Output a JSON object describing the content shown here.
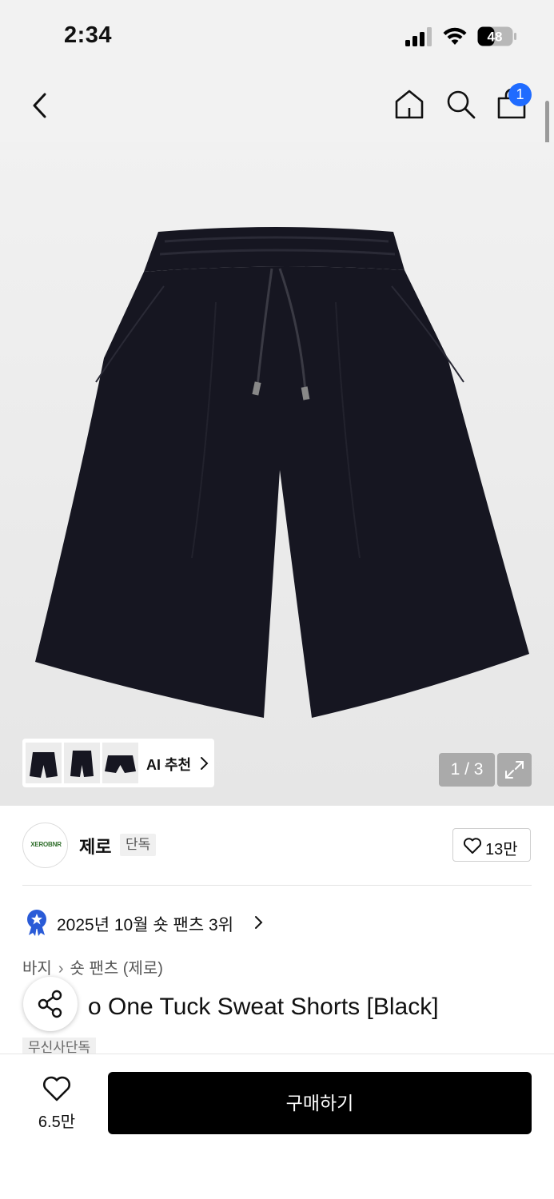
{
  "status_bar": {
    "time": "2:34",
    "battery": "48"
  },
  "nav": {
    "cart_count": "1"
  },
  "gallery": {
    "ai_label": "AI 추천",
    "page_counter": "1 / 3"
  },
  "brand": {
    "logo_text": "XEROBNR",
    "name": "제로",
    "tag": "단독",
    "like_count": "13만"
  },
  "ranking": {
    "text": "2025년 10월 숏 팬츠 3위"
  },
  "breadcrumb": {
    "level1": "바지",
    "level2": "숏 팬츠 (제로)"
  },
  "product": {
    "title": "o One Tuck Sweat Shorts [Black]",
    "exclusive_tag": "무신사단독"
  },
  "bottom_bar": {
    "wish_count": "6.5만",
    "buy_label": "구매하기"
  },
  "colors": {
    "accent": "#1f6bff",
    "buy_button": "#000000",
    "badge_star": "#2a5bd7"
  },
  "icons": [
    "back-icon",
    "home-icon",
    "search-icon",
    "shopping-bag-icon",
    "expand-icon",
    "heart-icon",
    "share-icon",
    "ranking-badge-icon",
    "chevron-right-icon"
  ]
}
